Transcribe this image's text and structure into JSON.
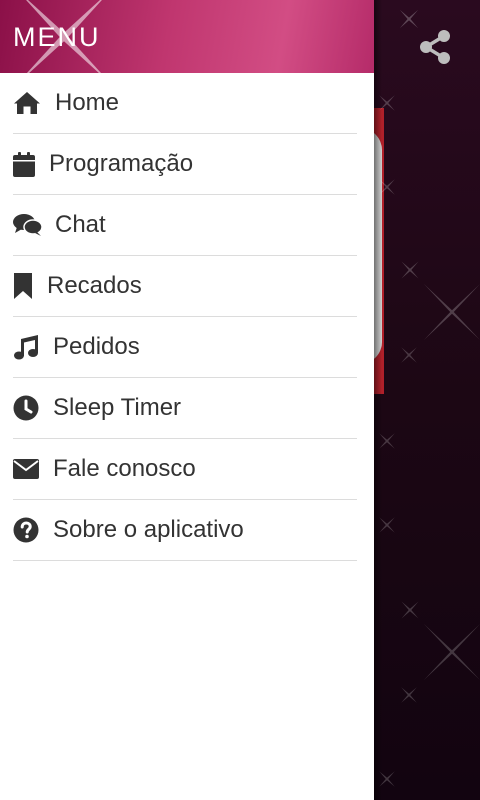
{
  "drawer": {
    "title": "MENU",
    "items": [
      {
        "label": "Home",
        "icon": "home-icon"
      },
      {
        "label": "Programação",
        "icon": "calendar-icon"
      },
      {
        "label": "Chat",
        "icon": "chat-icon"
      },
      {
        "label": "Recados",
        "icon": "bookmark-icon"
      },
      {
        "label": "Pedidos",
        "icon": "music-note-icon"
      },
      {
        "label": "Sleep Timer",
        "icon": "clock-icon"
      },
      {
        "label": "Fale conosco",
        "icon": "envelope-icon"
      },
      {
        "label": "Sobre o aplicativo",
        "icon": "question-circle-icon"
      }
    ]
  },
  "background": {
    "share_icon": "share-icon"
  },
  "colors": {
    "header_accent": "#c0366f",
    "text": "#333333",
    "divider": "#dcdcdc",
    "backdrop": "#1c0714"
  }
}
